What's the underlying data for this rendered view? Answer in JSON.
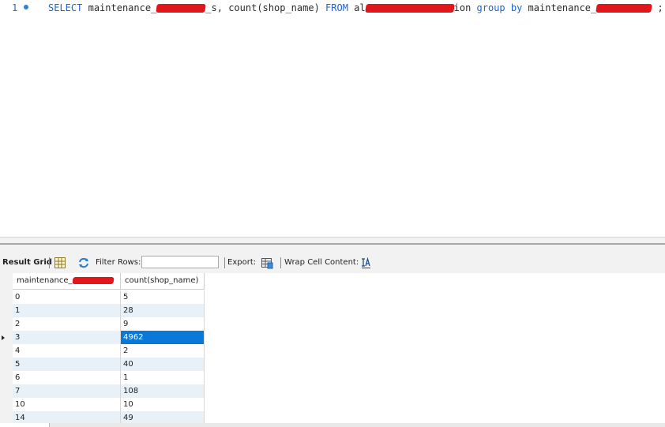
{
  "editor": {
    "line_number": "1",
    "code": {
      "select": "SELECT",
      "col_prefix": "maintenance_",
      "col_suffix": "_s,",
      "count_expr": " count(shop_name) ",
      "from": "FROM",
      "table_prefix": " al",
      "table_suffix": "ion ",
      "group_by": "group by",
      "group_col_prefix": " maintenance_",
      "terminator": " ;"
    }
  },
  "toolbar": {
    "result_grid_label": "Result Grid",
    "filter_rows_label": "Filter Rows:",
    "filter_value": "",
    "export_label": "Export:",
    "wrap_label": "Wrap Cell Content:"
  },
  "grid": {
    "columns": [
      "maintenance_",
      "count(shop_name)"
    ],
    "rows": [
      [
        "0",
        "5"
      ],
      [
        "1",
        "28"
      ],
      [
        "2",
        "9"
      ],
      [
        "3",
        "4962"
      ],
      [
        "4",
        "2"
      ],
      [
        "5",
        "40"
      ],
      [
        "6",
        "1"
      ],
      [
        "7",
        "108"
      ],
      [
        "10",
        "10"
      ],
      [
        "14",
        "49"
      ]
    ],
    "selected_row": 3,
    "selected_color": "#0a78d7"
  },
  "colors": {
    "keyword": "#1a64d6",
    "redaction": "#e0161b",
    "alt_row": "#e8f0f8"
  }
}
